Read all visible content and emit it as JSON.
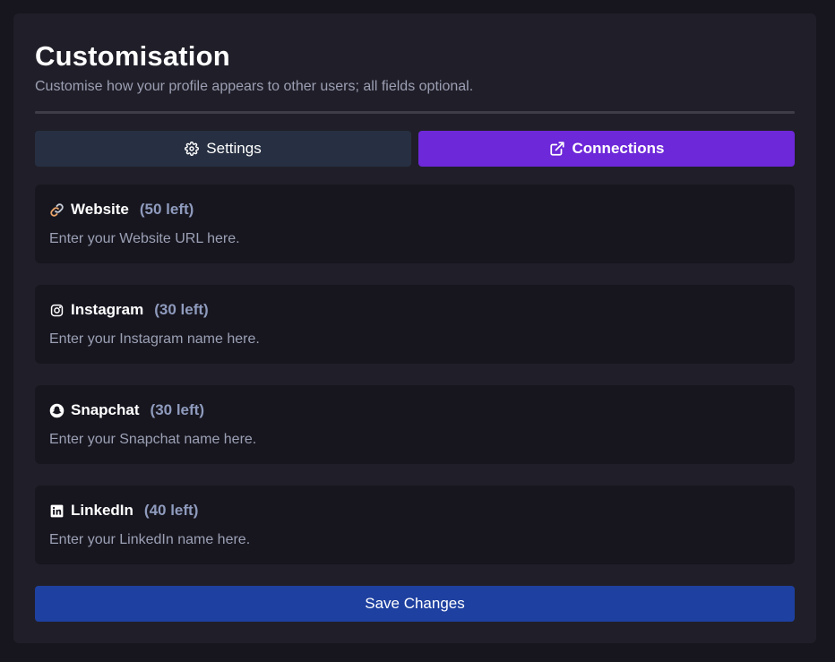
{
  "header": {
    "title": "Customisation",
    "subtitle": "Customise how your profile appears to other users; all fields optional."
  },
  "tabs": [
    {
      "label": "Settings",
      "icon": "gear-icon",
      "active": false
    },
    {
      "label": "Connections",
      "icon": "external-link-icon",
      "active": true
    }
  ],
  "fields": [
    {
      "icon": "link-icon",
      "name": "Website",
      "remaining": "(50 left)",
      "value": "",
      "placeholder": "Enter your Website URL here."
    },
    {
      "icon": "instagram-icon",
      "name": "Instagram",
      "remaining": "(30 left)",
      "value": "",
      "placeholder": "Enter your Instagram name here."
    },
    {
      "icon": "snapchat-icon",
      "name": "Snapchat",
      "remaining": "(30 left)",
      "value": "",
      "placeholder": "Enter your Snapchat name here."
    },
    {
      "icon": "linkedin-icon",
      "name": "LinkedIn",
      "remaining": "(40 left)",
      "value": "",
      "placeholder": "Enter your LinkedIn name here."
    }
  ],
  "save_label": "Save Changes",
  "colors": {
    "page_bg": "#17161e",
    "card_bg": "#201f29",
    "tab_inactive": "#273042",
    "tab_active": "#6d28d9",
    "field_bg": "#17161f",
    "remaining_text": "#8f9bbd",
    "save_button": "#1e40a0"
  }
}
